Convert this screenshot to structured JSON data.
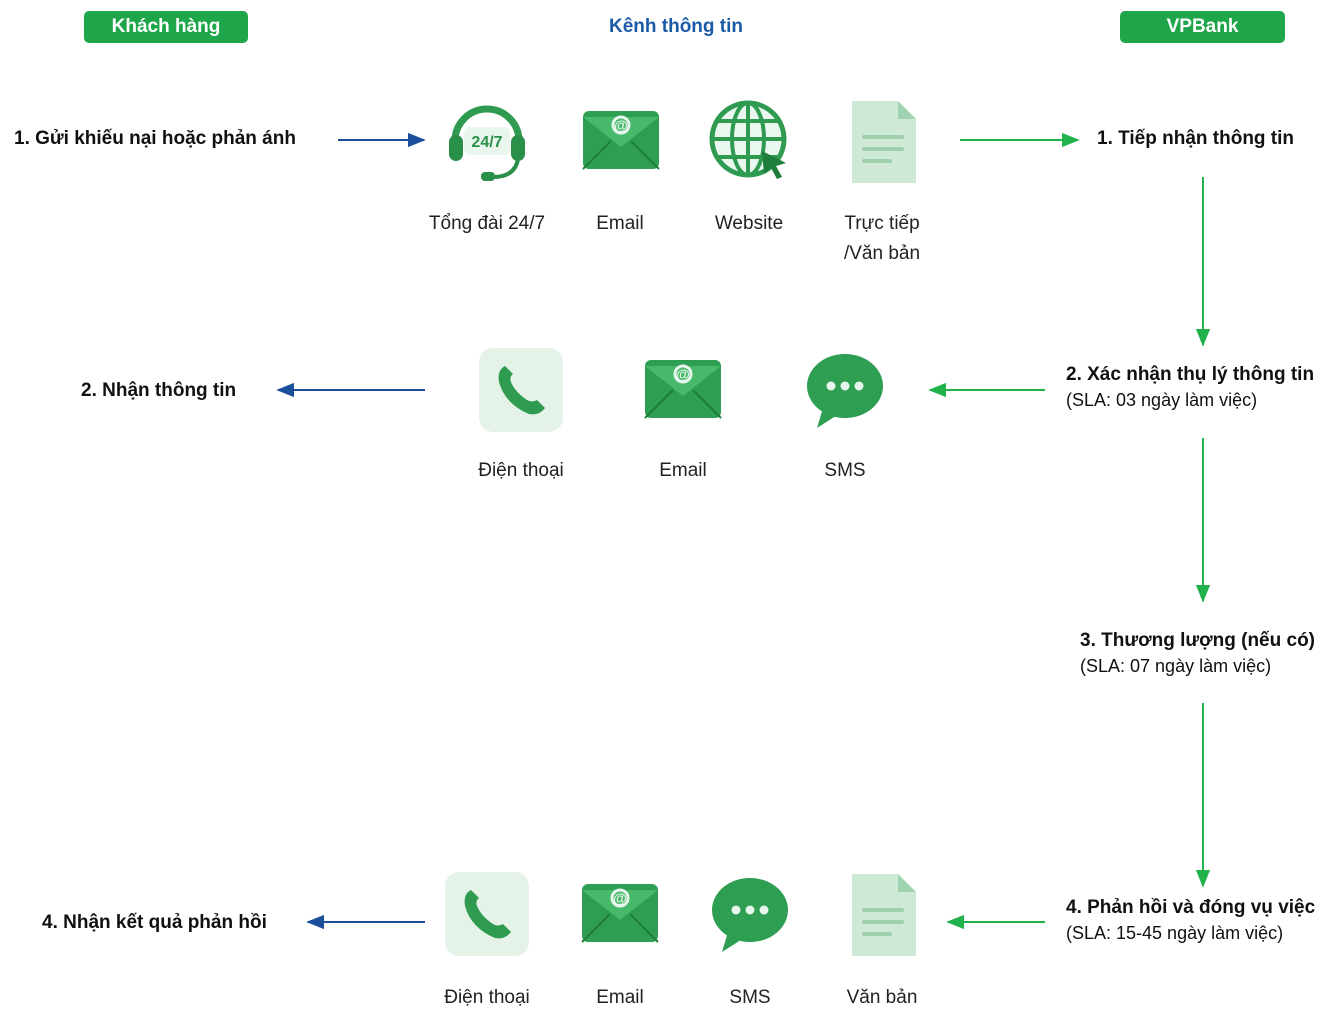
{
  "header": {
    "customer": "Khách hàng",
    "channel": "Kênh thông tin",
    "bank": "VPBank"
  },
  "row1": {
    "customer_step": "1. Gửi khiếu nại hoặc phản ánh",
    "bank_step": "1. Tiếp nhận thông tin",
    "channels": [
      {
        "icon": "headset-24-7-icon",
        "label": "Tổng đài 24/7"
      },
      {
        "icon": "email-icon",
        "label": "Email"
      },
      {
        "icon": "globe-cursor-icon",
        "label": "Website"
      },
      {
        "icon": "document-icon",
        "label_line1": "Trực tiếp",
        "label_line2": "/Văn bản"
      }
    ]
  },
  "row2": {
    "customer_step": "2. Nhận thông tin",
    "bank_step": "2. Xác nhận thụ lý thông tin",
    "bank_sla": "(SLA: 03 ngày làm việc)",
    "channels": [
      {
        "icon": "phone-icon",
        "label": "Điện thoại"
      },
      {
        "icon": "email-icon",
        "label": "Email"
      },
      {
        "icon": "sms-bubble-icon",
        "label": "SMS"
      }
    ]
  },
  "row3": {
    "bank_step": "3. Thương lượng (nếu có)",
    "bank_sla": "(SLA: 07 ngày làm việc)"
  },
  "row4": {
    "customer_step": "4. Nhận kết quả phản hồi",
    "bank_step": "4. Phản hồi và đóng vụ việc",
    "bank_sla": "(SLA: 15-45 ngày làm việc)",
    "channels": [
      {
        "icon": "phone-icon",
        "label": "Điện thoại"
      },
      {
        "icon": "email-icon",
        "label": "Email"
      },
      {
        "icon": "sms-bubble-icon",
        "label": "SMS"
      },
      {
        "icon": "document-icon",
        "label": "Văn bản"
      }
    ]
  },
  "colors": {
    "green": "#1fa64a",
    "blue_arrow": "#1b4f9c",
    "green_arrow": "#22b24c"
  }
}
